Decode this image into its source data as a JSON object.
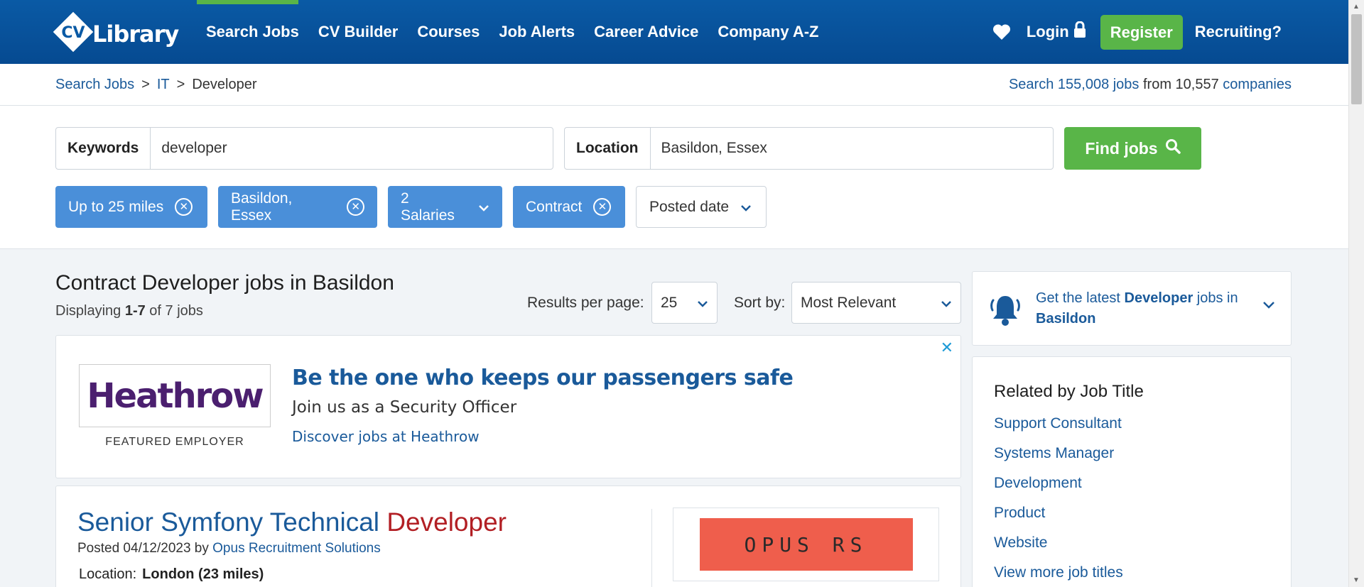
{
  "header": {
    "logo_text": "CV Library",
    "nav": [
      {
        "label": "Search Jobs"
      },
      {
        "label": "CV Builder"
      },
      {
        "label": "Courses"
      },
      {
        "label": "Job Alerts"
      },
      {
        "label": "Career Advice"
      },
      {
        "label": "Company A-Z"
      }
    ],
    "login_label": "Login",
    "register_label": "Register",
    "recruiting_label": "Recruiting?",
    "active_color": "#59b548"
  },
  "breadcrumb": {
    "items": [
      {
        "label": "Search Jobs"
      },
      {
        "label": "IT"
      },
      {
        "label": "Developer"
      }
    ],
    "separator": ">"
  },
  "stats": {
    "prefix": "Search ",
    "jobs_link": "155,008 jobs",
    "middle": " from 10,557 ",
    "companies_link": "companies"
  },
  "search": {
    "keywords_label": "Keywords",
    "keywords_value": "developer",
    "location_label": "Location",
    "location_value": "Basildon, Essex",
    "find_label": "Find jobs"
  },
  "filters": [
    {
      "label": "Up to 25 miles",
      "kind": "remove"
    },
    {
      "label": "Basildon, Essex",
      "kind": "remove"
    },
    {
      "label": "2 Salaries",
      "kind": "dropdown"
    },
    {
      "label": "Contract",
      "kind": "remove"
    },
    {
      "label": "Posted date",
      "kind": "dropdown"
    }
  ],
  "results": {
    "title": "Contract Developer jobs in Basildon",
    "count_prefix": "Displaying ",
    "count_range": "1-7",
    "count_suffix": " of 7 jobs",
    "per_page_label": "Results per page:",
    "per_page_value": "25",
    "sort_label": "Sort by:",
    "sort_value": "Most Relevant"
  },
  "ad": {
    "close": "✕",
    "logo_text": "Heathrow",
    "featured": "FEATURED EMPLOYER",
    "headline": "Be the one who keeps our passengers safe",
    "sub": "Join us as a Security Officer",
    "link": "Discover jobs at Heathrow"
  },
  "job": {
    "title_main": "Senior Symfony Technical ",
    "title_highlight": "Developer",
    "posted_prefix": "Posted 04/12/2023 by ",
    "company": "Opus Recruitment Solutions",
    "location_label": "Location:",
    "location_value": "London (23 miles)",
    "logo_text": "OPUS RS",
    "logo_color": "#ef5e4c"
  },
  "alert": {
    "pre": "Get the latest ",
    "role": "Developer",
    "mid": " jobs in ",
    "place": "Basildon"
  },
  "related": {
    "heading": "Related by Job Title",
    "items": [
      {
        "label": "Support Consultant"
      },
      {
        "label": "Systems Manager"
      },
      {
        "label": "Development"
      },
      {
        "label": "Product"
      },
      {
        "label": "Website"
      },
      {
        "label": "View more job titles"
      }
    ]
  }
}
